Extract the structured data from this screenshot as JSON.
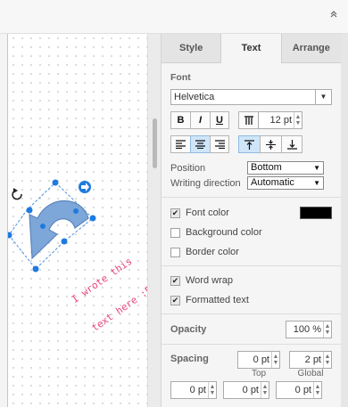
{
  "topbar": {
    "collapse_icon": "double-chevron-up-icon",
    "collapse_glyph": "«"
  },
  "canvas": {
    "text_lines": [
      "I wrote this",
      "text here :P"
    ],
    "accent": "#e8467c",
    "shape_fill": "#7da7d9"
  },
  "tabs": [
    {
      "label": "Style",
      "active": false
    },
    {
      "label": "Text",
      "active": true
    },
    {
      "label": "Arrange",
      "active": false
    }
  ],
  "font": {
    "section_title": "Font",
    "family": "Helvetica",
    "bold": "B",
    "italic": "I",
    "underline": "U",
    "size": "12 pt",
    "position_label": "Position",
    "position_value": "Bottom",
    "writing_direction_label": "Writing direction",
    "writing_direction_value": "Automatic"
  },
  "colors": {
    "font_color_label": "Font color",
    "font_color_checked": true,
    "font_color_value": "#000000",
    "background_color_label": "Background color",
    "background_color_checked": false,
    "border_color_label": "Border color",
    "border_color_checked": false
  },
  "wrap": {
    "word_wrap_label": "Word wrap",
    "word_wrap_checked": true,
    "formatted_text_label": "Formatted text",
    "formatted_text_checked": true
  },
  "opacity": {
    "label": "Opacity",
    "value": "100 %"
  },
  "spacing": {
    "label": "Spacing",
    "top_value": "0 pt",
    "global_value": "2 pt",
    "top_label": "Top",
    "global_label": "Global",
    "left_value": "0 pt",
    "bottom_value": "0 pt",
    "right_value": "0 pt"
  }
}
